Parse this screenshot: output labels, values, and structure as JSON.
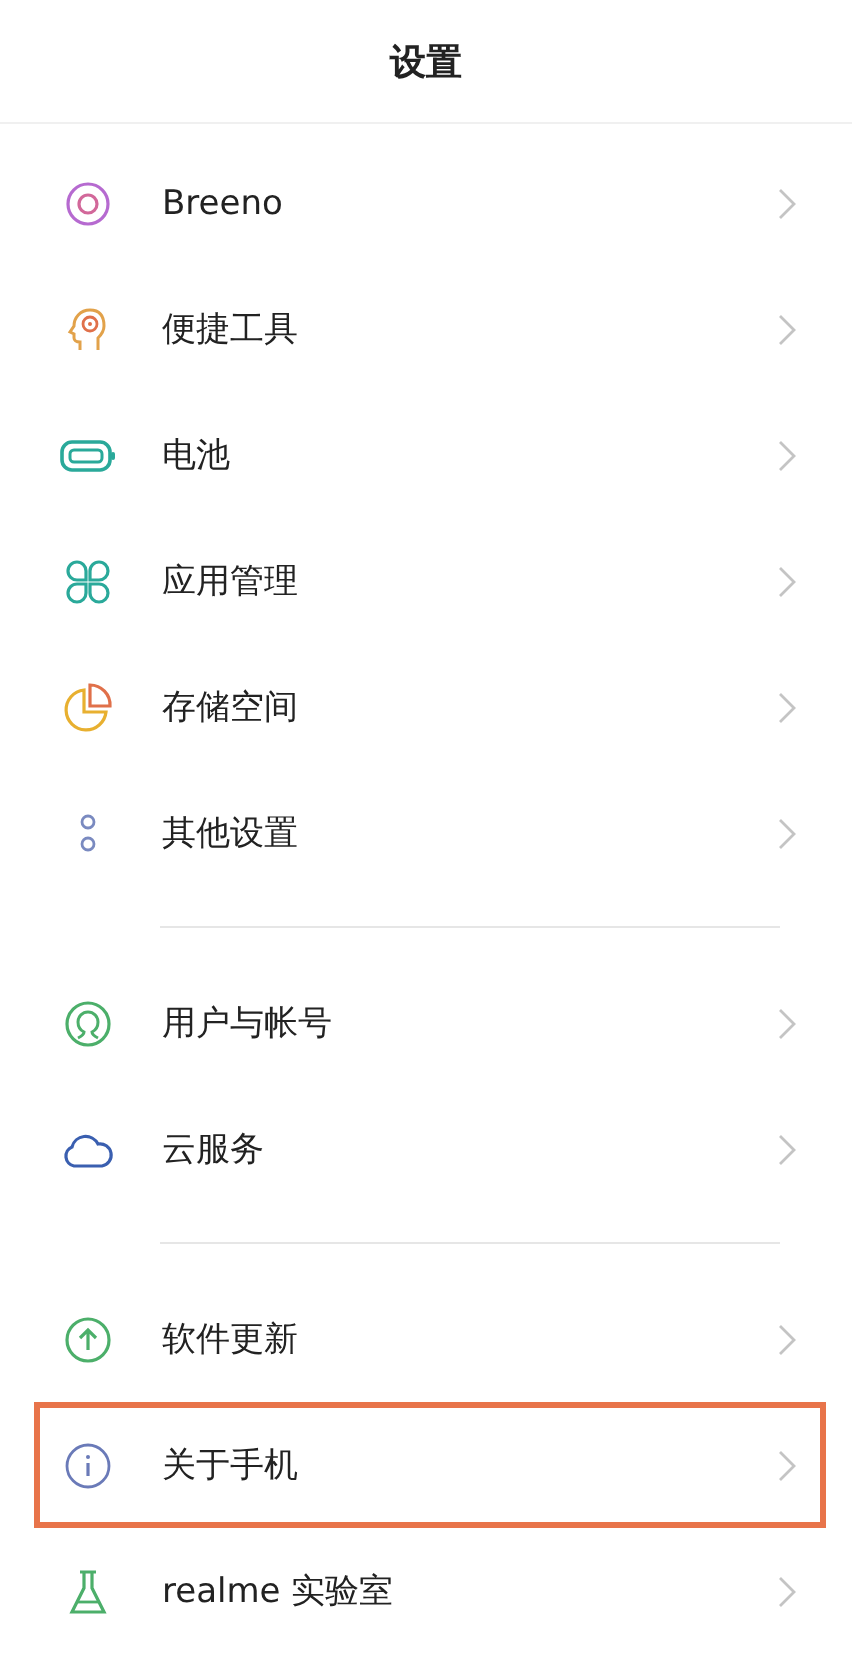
{
  "header": {
    "title": "设置"
  },
  "sections": [
    {
      "items": [
        {
          "label": "Breeno",
          "highlighted": false
        },
        {
          "label": "便捷工具",
          "highlighted": false
        },
        {
          "label": "电池",
          "highlighted": false
        },
        {
          "label": "应用管理",
          "highlighted": false
        },
        {
          "label": "存储空间",
          "highlighted": false
        },
        {
          "label": "其他设置",
          "highlighted": false
        }
      ]
    },
    {
      "items": [
        {
          "label": "用户与帐号",
          "highlighted": false
        },
        {
          "label": "云服务",
          "highlighted": false
        }
      ]
    },
    {
      "items": [
        {
          "label": "软件更新",
          "highlighted": false
        },
        {
          "label": "关于手机",
          "highlighted": true
        },
        {
          "label": "realme 实验室",
          "highlighted": false
        }
      ]
    }
  ]
}
